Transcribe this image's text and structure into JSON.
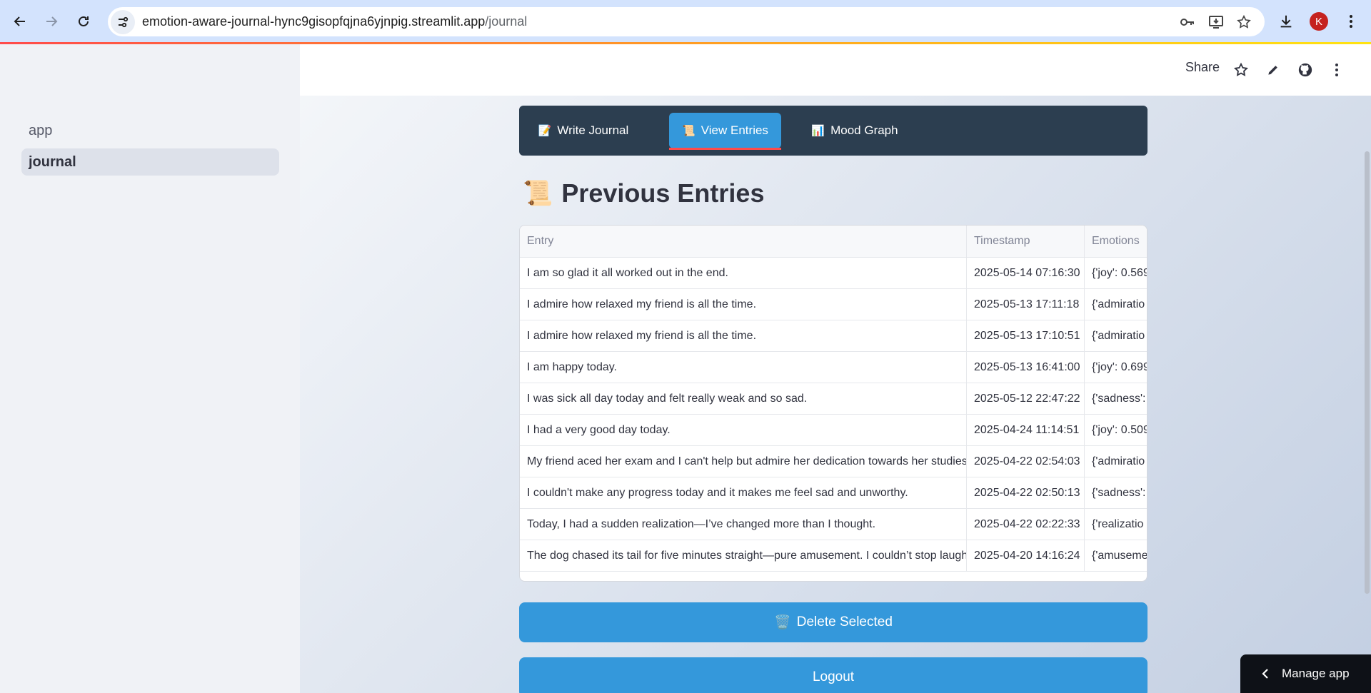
{
  "browser": {
    "url_host": "emotion-aware-journal-hync9gisopfqjna6yjnpig.streamlit.app",
    "url_path": "/journal",
    "profile_initial": "K"
  },
  "sidebar": {
    "items": [
      {
        "label": "app"
      },
      {
        "label": "journal"
      }
    ]
  },
  "topbar": {
    "share_label": "Share"
  },
  "tabs": [
    {
      "icon": "📝",
      "label": "Write Journal"
    },
    {
      "icon": "📜",
      "label": "View Entries"
    },
    {
      "icon": "📊",
      "label": "Mood Graph"
    }
  ],
  "page": {
    "icon": "📜",
    "title": "Previous Entries"
  },
  "table": {
    "columns": [
      "Entry",
      "Timestamp",
      "Emotions"
    ],
    "rows": [
      {
        "entry": "I am so glad it all worked out in the end.",
        "timestamp": "2025-05-14 07:16:30",
        "emotions": "{'joy': 0.569"
      },
      {
        "entry": "I admire how relaxed my friend is all the time.",
        "timestamp": "2025-05-13 17:11:18",
        "emotions": "{'admiratio"
      },
      {
        "entry": "I admire how relaxed my friend is all the time.",
        "timestamp": "2025-05-13 17:10:51",
        "emotions": "{'admiratio"
      },
      {
        "entry": "I am happy today.",
        "timestamp": "2025-05-13 16:41:00",
        "emotions": "{'joy': 0.699"
      },
      {
        "entry": "I was sick all day today and felt really weak and so sad.",
        "timestamp": "2025-05-12 22:47:22",
        "emotions": "{'sadness':"
      },
      {
        "entry": "I had a very good day today.",
        "timestamp": "2025-04-24 11:14:51",
        "emotions": "{'joy': 0.509"
      },
      {
        "entry": "My friend aced her exam and I can't help but admire her dedication towards her studies",
        "timestamp": "2025-04-22 02:54:03",
        "emotions": "{'admiratio"
      },
      {
        "entry": "I couldn't make any progress today and it makes me feel sad and unworthy.",
        "timestamp": "2025-04-22 02:50:13",
        "emotions": "{'sadness':"
      },
      {
        "entry": "Today, I had a sudden realization—I’ve changed more than I thought.",
        "timestamp": "2025-04-22 02:22:33",
        "emotions": "{'realizatio"
      },
      {
        "entry": "The dog chased its tail for five minutes straight—pure amusement. I couldn’t stop laughing",
        "timestamp": "2025-04-20 14:16:24",
        "emotions": "{'amuseme"
      }
    ]
  },
  "buttons": {
    "delete_icon": "🗑️",
    "delete_label": "Delete Selected",
    "logout_label": "Logout"
  },
  "manage_app_label": "Manage app"
}
